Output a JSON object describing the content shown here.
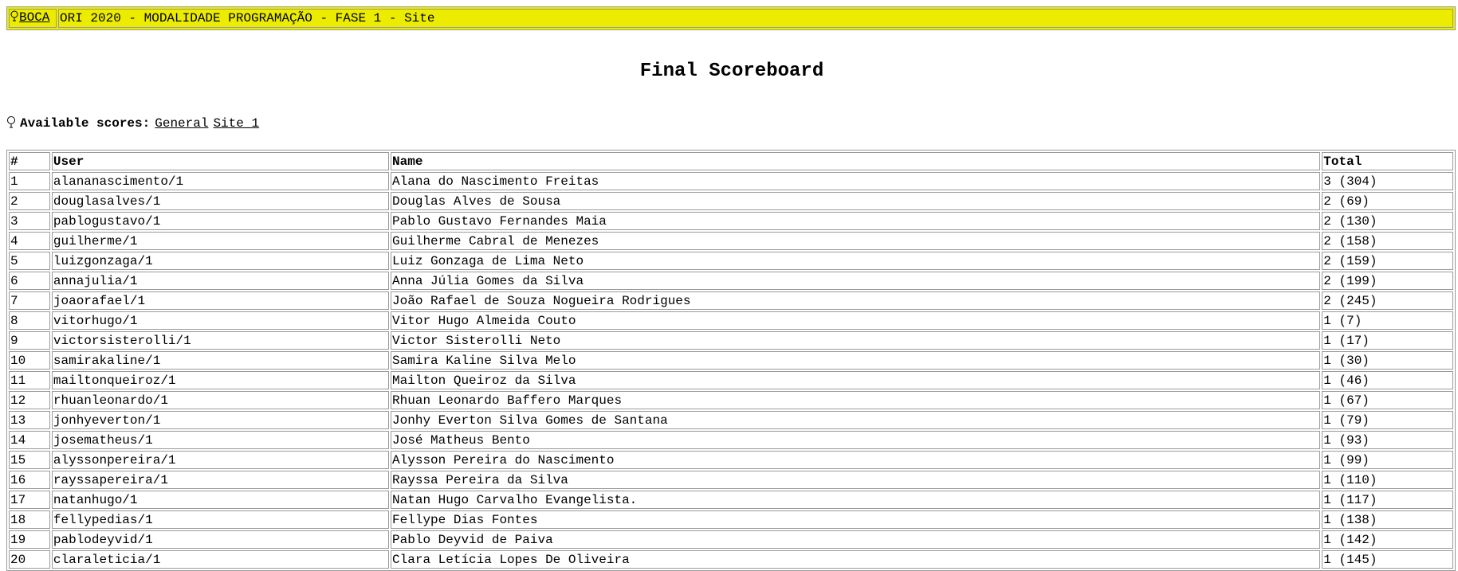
{
  "header": {
    "logo_label": "BOCA",
    "contest_title": "ORI 2020 - MODALIDADE PROGRAMAÇÃO - FASE 1 - Site"
  },
  "page": {
    "title": "Final Scoreboard"
  },
  "scores": {
    "label": "Available scores:",
    "links": [
      "General",
      "Site_1"
    ]
  },
  "table": {
    "columns": [
      "#",
      "User",
      "Name",
      "Total"
    ],
    "rows": [
      {
        "rank": "1",
        "user": "alananascimento/1",
        "name": "Alana do Nascimento Freitas",
        "total": "3 (304)"
      },
      {
        "rank": "2",
        "user": "douglasalves/1",
        "name": "Douglas Alves de Sousa",
        "total": "2 (69)"
      },
      {
        "rank": "3",
        "user": "pablogustavo/1",
        "name": "Pablo Gustavo Fernandes Maia",
        "total": "2 (130)"
      },
      {
        "rank": "4",
        "user": "guilherme/1",
        "name": "Guilherme Cabral de Menezes",
        "total": "2 (158)"
      },
      {
        "rank": "5",
        "user": "luizgonzaga/1",
        "name": "Luiz Gonzaga de Lima Neto",
        "total": "2 (159)"
      },
      {
        "rank": "6",
        "user": "annajulia/1",
        "name": "Anna Júlia Gomes da Silva",
        "total": "2 (199)"
      },
      {
        "rank": "7",
        "user": "joaorafael/1",
        "name": "João Rafael de Souza Nogueira Rodrigues",
        "total": "2 (245)"
      },
      {
        "rank": "8",
        "user": "vitorhugo/1",
        "name": "Vitor Hugo Almeida Couto",
        "total": "1 (7)"
      },
      {
        "rank": "9",
        "user": "victorsisterolli/1",
        "name": "Victor Sisterolli Neto",
        "total": "1 (17)"
      },
      {
        "rank": "10",
        "user": "samirakaline/1",
        "name": "Samira Kaline Silva Melo",
        "total": "1 (30)"
      },
      {
        "rank": "11",
        "user": "mailtonqueiroz/1",
        "name": "Mailton Queiroz da Silva",
        "total": "1 (46)"
      },
      {
        "rank": "12",
        "user": "rhuanleonardo/1",
        "name": "Rhuan Leonardo Baffero Marques",
        "total": "1 (67)"
      },
      {
        "rank": "13",
        "user": "jonhyeverton/1",
        "name": "Jonhy Everton Silva Gomes de Santana",
        "total": "1 (79)"
      },
      {
        "rank": "14",
        "user": "josematheus/1",
        "name": "José Matheus Bento",
        "total": "1 (93)"
      },
      {
        "rank": "15",
        "user": "alyssonpereira/1",
        "name": "Alysson Pereira do Nascimento",
        "total": "1 (99)"
      },
      {
        "rank": "16",
        "user": "rayssapereira/1",
        "name": "Rayssa Pereira da Silva",
        "total": "1 (110)"
      },
      {
        "rank": "17",
        "user": "natanhugo/1",
        "name": "Natan Hugo Carvalho Evangelista.",
        "total": "1 (117)"
      },
      {
        "rank": "18",
        "user": "fellypedias/1",
        "name": "Fellype Dias Fontes",
        "total": "1 (138)"
      },
      {
        "rank": "19",
        "user": "pablodeyvid/1",
        "name": "Pablo Deyvid de Paiva",
        "total": "1 (142)"
      },
      {
        "rank": "20",
        "user": "claraleticia/1",
        "name": "Clara Letícia Lopes De Oliveira",
        "total": "1 (145)"
      }
    ]
  },
  "icons": {
    "logo_icon": "lightbulb-icon",
    "scores_icon": "lightbulb-icon"
  },
  "colors": {
    "header_background": "#ecec00",
    "border": "#9a9a9a"
  }
}
